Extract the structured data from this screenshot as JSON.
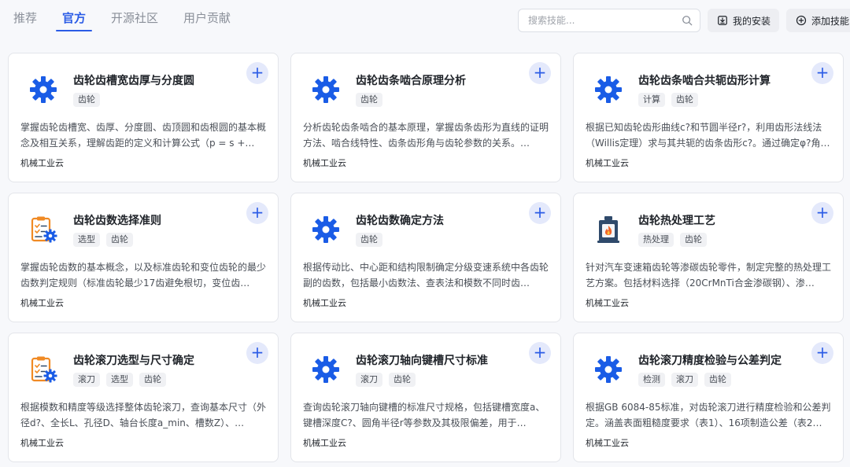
{
  "tabs": [
    "推荐",
    "官方",
    "开源社区",
    "用户贡献"
  ],
  "active_tab": 1,
  "search": {
    "placeholder": "搜索技能..."
  },
  "buttons": {
    "my_install": "我的安装",
    "add_skill": "添加技能"
  },
  "cards": [
    {
      "title": "齿轮齿槽宽齿厚与分度圆",
      "icon": "gear-icon",
      "tags": [
        "齿轮"
      ],
      "desc": "掌握齿轮齿槽宽、齿厚、分度圆、齿顶圆和齿根圆的基本概念及相互关系，理解齿距的定义和计算公式（p = s +…",
      "source": "机械工业云"
    },
    {
      "title": "齿轮齿条啮合原理分析",
      "icon": "gear-icon",
      "tags": [
        "齿轮"
      ],
      "desc": "分析齿轮齿条啮合的基本原理，掌握齿条齿形为直线的证明方法、啮合线特性、齿条齿形角与齿轮参数的关系。…",
      "source": "机械工业云"
    },
    {
      "title": "齿轮齿条啮合共轭齿形计算",
      "icon": "gear-icon",
      "tags": [
        "计算",
        "齿轮"
      ],
      "desc": "根据已知齿轮齿形曲线c?和节圆半径r?，利用齿形法线法（Willis定理）求与其共轭的齿条齿形c?。通过确定φ?角…",
      "source": "机械工业云"
    },
    {
      "title": "齿轮齿数选择准则",
      "icon": "clipboard-gear-icon",
      "tags": [
        "选型",
        "齿轮"
      ],
      "desc": "掌握齿轮齿数的基本概念，以及标准齿轮和变位齿轮的最少齿数判定规则（标准齿轮最少17齿避免根切，变位齿…",
      "source": "机械工业云"
    },
    {
      "title": "齿轮齿数确定方法",
      "icon": "gear-icon",
      "tags": [
        "齿轮"
      ],
      "desc": "根据传动比、中心距和结构限制确定分级变速系统中各齿轮副的齿数，包括最小齿数法、查表法和模数不同时齿…",
      "source": "机械工业云"
    },
    {
      "title": "齿轮热处理工艺",
      "icon": "furnace-icon",
      "tags": [
        "热处理",
        "齿轮"
      ],
      "desc": "针对汽车变速箱齿轮等渗碳齿轮零件，制定完整的热处理工艺方案。包括材料选择（20CrMnTi合金渗碳钢）、渗…",
      "source": "机械工业云"
    },
    {
      "title": "齿轮滚刀选型与尺寸确定",
      "icon": "clipboard-gear-icon",
      "tags": [
        "滚刀",
        "选型",
        "齿轮"
      ],
      "desc": "根据模数和精度等级选择整体齿轮滚刀，查询基本尺寸（外径d?、全长L、孔径D、轴台长度a_min、槽数Z）、…",
      "source": "机械工业云"
    },
    {
      "title": "齿轮滚刀轴向键槽尺寸标准",
      "icon": "gear-icon",
      "tags": [
        "滚刀",
        "齿轮"
      ],
      "desc": "查询齿轮滚刀轴向键槽的标准尺寸规格，包括键槽宽度a、键槽深度C?、圆角半径r等参数及其极限偏差，用于…",
      "source": "机械工业云"
    },
    {
      "title": "齿轮滚刀精度检验与公差判定",
      "icon": "gear-icon",
      "tags": [
        "检测",
        "滚刀",
        "齿轮"
      ],
      "desc": "根据GB 6084-85标准，对齿轮滚刀进行精度检验和公差判定。涵盖表面粗糙度要求（表1）、16项制造公差（表2…",
      "source": "机械工业云"
    }
  ],
  "colors": {
    "accent": "#2b5ce6",
    "gear": "#1a5ce6",
    "clipboard": "#f08a24",
    "furnace": "#2f4a6b"
  }
}
